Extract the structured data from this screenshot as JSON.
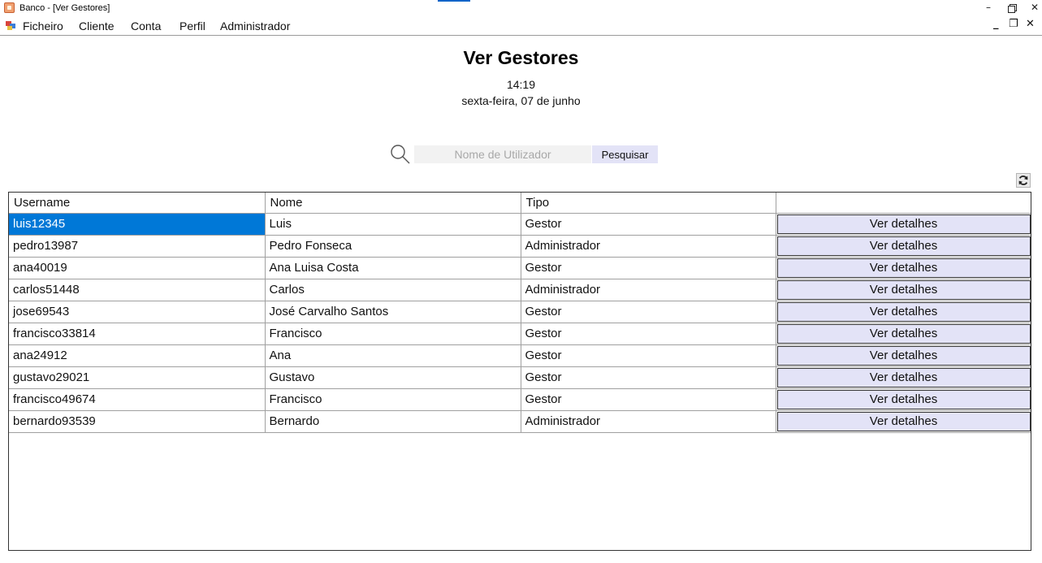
{
  "window": {
    "title": "Banco - [Ver Gestores]",
    "controls": {
      "minimize": "–",
      "close": "✕"
    }
  },
  "menu": {
    "items": [
      "Ficheiro",
      "Cliente",
      "Conta",
      "Perfil",
      "Administrador"
    ],
    "mdi_controls": {
      "minimize": "_",
      "restore": "❐",
      "close": "✕"
    }
  },
  "page": {
    "title": "Ver Gestores",
    "time": "14:19",
    "date": "sexta-feira, 07 de junho"
  },
  "search": {
    "placeholder": "Nome de Utilizador",
    "value": "",
    "button_label": "Pesquisar"
  },
  "icons": {
    "search": "search-icon",
    "refresh": "refresh-icon",
    "app": "app-icon",
    "mdi": "mdi-child-icon"
  },
  "colors": {
    "selection": "#0078d7",
    "button_bg": "#e3e3f7"
  },
  "table": {
    "columns": [
      "Username",
      "Nome",
      "Tipo",
      ""
    ],
    "selected_row": 0,
    "rows": [
      {
        "username": "luis12345",
        "nome": "Luis",
        "tipo": "Gestor",
        "action": "Ver detalhes"
      },
      {
        "username": "pedro13987",
        "nome": "Pedro Fonseca",
        "tipo": "Administrador",
        "action": "Ver detalhes"
      },
      {
        "username": "ana40019",
        "nome": "Ana Luisa Costa",
        "tipo": "Gestor",
        "action": "Ver detalhes"
      },
      {
        "username": "carlos51448",
        "nome": "Carlos",
        "tipo": "Administrador",
        "action": "Ver detalhes"
      },
      {
        "username": "jose69543",
        "nome": "José Carvalho Santos",
        "tipo": "Gestor",
        "action": "Ver detalhes"
      },
      {
        "username": "francisco33814",
        "nome": "Francisco",
        "tipo": "Gestor",
        "action": "Ver detalhes"
      },
      {
        "username": "ana24912",
        "nome": "Ana",
        "tipo": "Gestor",
        "action": "Ver detalhes"
      },
      {
        "username": "gustavo29021",
        "nome": "Gustavo",
        "tipo": "Gestor",
        "action": "Ver detalhes"
      },
      {
        "username": "francisco49674",
        "nome": "Francisco",
        "tipo": "Gestor",
        "action": "Ver detalhes"
      },
      {
        "username": "bernardo93539",
        "nome": "Bernardo",
        "tipo": "Administrador",
        "action": "Ver detalhes"
      }
    ]
  }
}
